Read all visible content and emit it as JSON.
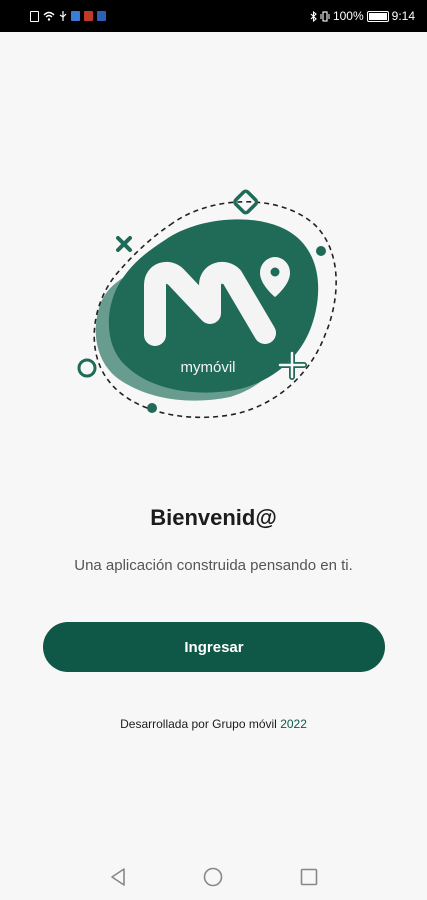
{
  "status_bar": {
    "battery": "100%",
    "time": "9:14",
    "icons": [
      "document-icon",
      "wifi-icon",
      "usb-icon",
      "app-notification-icon",
      "app-notification-icon",
      "app-notification-icon",
      "bluetooth-icon",
      "vibrate-icon",
      "battery-icon"
    ]
  },
  "logo": {
    "text": "mymóvil",
    "color": "#1f6b58"
  },
  "welcome": {
    "title": "Bienvenid@",
    "subtitle": "Una aplicación construida pensando en ti."
  },
  "login_button": {
    "label": "Ingresar",
    "color": "#0f5746"
  },
  "footer": {
    "text": "Desarrollada por Grupo móvil ",
    "year": "2022"
  },
  "nav_bar": {
    "icons": [
      "back-icon",
      "home-icon",
      "recents-icon"
    ]
  }
}
